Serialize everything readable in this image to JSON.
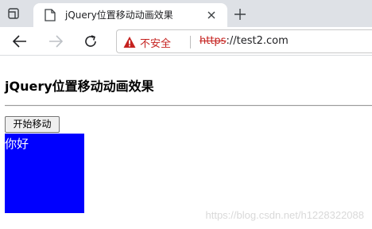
{
  "browser": {
    "tab": {
      "title": "jQuery位置移动动画效果"
    },
    "address_bar": {
      "security_label": "不安全",
      "url_scheme": "https",
      "url_rest": "://test2.com"
    },
    "colors": {
      "warning": "#c5221f",
      "tabstrip": "#dee1e6"
    },
    "icons": [
      "tab-actions-icon",
      "page-favicon-icon",
      "close-icon",
      "plus-icon",
      "back-arrow-icon",
      "forward-arrow-icon",
      "reload-icon",
      "warning-icon"
    ]
  },
  "page": {
    "title": "jQuery位置移动动画效果",
    "start_button_label": "开始移动",
    "box_text": "你好",
    "box_color": "#0000ff",
    "watermark": "https://blog.csdn.net/h1228322088"
  }
}
